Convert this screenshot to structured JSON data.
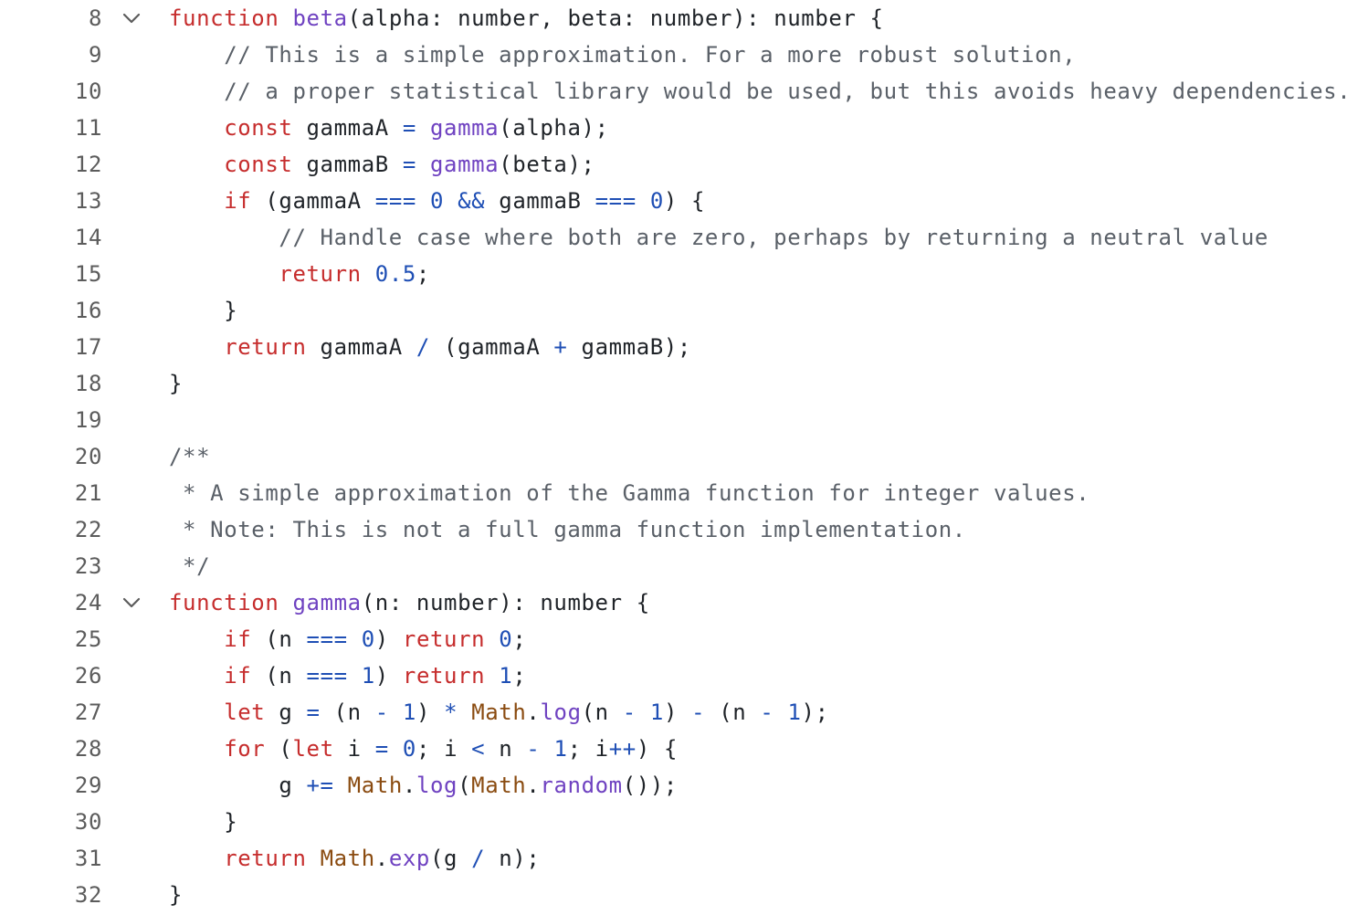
{
  "editor": {
    "language": "typescript",
    "colors": {
      "keyword": "#c62d2d",
      "function": "#6f42c1",
      "operator": "#1f4fb5",
      "number": "#1f4fb5",
      "comment": "#5a6068",
      "class": "#8a4b10",
      "text": "#1f2328",
      "line_number": "#5c5c5c"
    },
    "fold_icon": "chevron-down-icon",
    "lines": [
      {
        "num": "8",
        "fold": true,
        "tokens": [
          {
            "t": "kw",
            "v": "function"
          },
          {
            "t": "pl",
            "v": " "
          },
          {
            "t": "fn",
            "v": "beta"
          },
          {
            "t": "pl",
            "v": "(alpha: number, beta: number): number {"
          }
        ]
      },
      {
        "num": "9",
        "tokens": [
          {
            "t": "pl",
            "v": "    "
          },
          {
            "t": "cm",
            "v": "// This is a simple approximation. For a more robust solution,"
          }
        ]
      },
      {
        "num": "10",
        "tokens": [
          {
            "t": "pl",
            "v": "    "
          },
          {
            "t": "cm",
            "v": "// a proper statistical library would be used, but this avoids heavy dependencies."
          }
        ]
      },
      {
        "num": "11",
        "tokens": [
          {
            "t": "pl",
            "v": "    "
          },
          {
            "t": "kw",
            "v": "const"
          },
          {
            "t": "pl",
            "v": " gammaA "
          },
          {
            "t": "op",
            "v": "="
          },
          {
            "t": "pl",
            "v": " "
          },
          {
            "t": "fn",
            "v": "gamma"
          },
          {
            "t": "pl",
            "v": "(alpha);"
          }
        ]
      },
      {
        "num": "12",
        "tokens": [
          {
            "t": "pl",
            "v": "    "
          },
          {
            "t": "kw",
            "v": "const"
          },
          {
            "t": "pl",
            "v": " gammaB "
          },
          {
            "t": "op",
            "v": "="
          },
          {
            "t": "pl",
            "v": " "
          },
          {
            "t": "fn",
            "v": "gamma"
          },
          {
            "t": "pl",
            "v": "(beta);"
          }
        ]
      },
      {
        "num": "13",
        "tokens": [
          {
            "t": "pl",
            "v": "    "
          },
          {
            "t": "kw",
            "v": "if"
          },
          {
            "t": "pl",
            "v": " (gammaA "
          },
          {
            "t": "op",
            "v": "==="
          },
          {
            "t": "pl",
            "v": " "
          },
          {
            "t": "num",
            "v": "0"
          },
          {
            "t": "pl",
            "v": " "
          },
          {
            "t": "op",
            "v": "&&"
          },
          {
            "t": "pl",
            "v": " gammaB "
          },
          {
            "t": "op",
            "v": "==="
          },
          {
            "t": "pl",
            "v": " "
          },
          {
            "t": "num",
            "v": "0"
          },
          {
            "t": "pl",
            "v": ") {"
          }
        ]
      },
      {
        "num": "14",
        "tokens": [
          {
            "t": "pl",
            "v": "        "
          },
          {
            "t": "cm",
            "v": "// Handle case where both are zero, perhaps by returning a neutral value"
          }
        ]
      },
      {
        "num": "15",
        "tokens": [
          {
            "t": "pl",
            "v": "        "
          },
          {
            "t": "kw",
            "v": "return"
          },
          {
            "t": "pl",
            "v": " "
          },
          {
            "t": "num",
            "v": "0.5"
          },
          {
            "t": "pl",
            "v": ";"
          }
        ]
      },
      {
        "num": "16",
        "tokens": [
          {
            "t": "pl",
            "v": "    }"
          }
        ]
      },
      {
        "num": "17",
        "tokens": [
          {
            "t": "pl",
            "v": "    "
          },
          {
            "t": "kw",
            "v": "return"
          },
          {
            "t": "pl",
            "v": " gammaA "
          },
          {
            "t": "op",
            "v": "/"
          },
          {
            "t": "pl",
            "v": " (gammaA "
          },
          {
            "t": "op",
            "v": "+"
          },
          {
            "t": "pl",
            "v": " gammaB);"
          }
        ]
      },
      {
        "num": "18",
        "tokens": [
          {
            "t": "pl",
            "v": "}"
          }
        ]
      },
      {
        "num": "19",
        "tokens": []
      },
      {
        "num": "20",
        "tokens": [
          {
            "t": "cm",
            "v": "/**"
          }
        ]
      },
      {
        "num": "21",
        "tokens": [
          {
            "t": "cm",
            "v": " * A simple approximation of the Gamma function for integer values."
          }
        ]
      },
      {
        "num": "22",
        "tokens": [
          {
            "t": "cm",
            "v": " * Note: This is not a full gamma function implementation."
          }
        ]
      },
      {
        "num": "23",
        "tokens": [
          {
            "t": "cm",
            "v": " */"
          }
        ]
      },
      {
        "num": "24",
        "fold": true,
        "tokens": [
          {
            "t": "kw",
            "v": "function"
          },
          {
            "t": "pl",
            "v": " "
          },
          {
            "t": "fn",
            "v": "gamma"
          },
          {
            "t": "pl",
            "v": "(n: number): number {"
          }
        ]
      },
      {
        "num": "25",
        "tokens": [
          {
            "t": "pl",
            "v": "    "
          },
          {
            "t": "kw",
            "v": "if"
          },
          {
            "t": "pl",
            "v": " (n "
          },
          {
            "t": "op",
            "v": "==="
          },
          {
            "t": "pl",
            "v": " "
          },
          {
            "t": "num",
            "v": "0"
          },
          {
            "t": "pl",
            "v": ") "
          },
          {
            "t": "kw",
            "v": "return"
          },
          {
            "t": "pl",
            "v": " "
          },
          {
            "t": "num",
            "v": "0"
          },
          {
            "t": "pl",
            "v": ";"
          }
        ]
      },
      {
        "num": "26",
        "tokens": [
          {
            "t": "pl",
            "v": "    "
          },
          {
            "t": "kw",
            "v": "if"
          },
          {
            "t": "pl",
            "v": " (n "
          },
          {
            "t": "op",
            "v": "==="
          },
          {
            "t": "pl",
            "v": " "
          },
          {
            "t": "num",
            "v": "1"
          },
          {
            "t": "pl",
            "v": ") "
          },
          {
            "t": "kw",
            "v": "return"
          },
          {
            "t": "pl",
            "v": " "
          },
          {
            "t": "num",
            "v": "1"
          },
          {
            "t": "pl",
            "v": ";"
          }
        ]
      },
      {
        "num": "27",
        "tokens": [
          {
            "t": "pl",
            "v": "    "
          },
          {
            "t": "kw",
            "v": "let"
          },
          {
            "t": "pl",
            "v": " g "
          },
          {
            "t": "op",
            "v": "="
          },
          {
            "t": "pl",
            "v": " (n "
          },
          {
            "t": "op",
            "v": "-"
          },
          {
            "t": "pl",
            "v": " "
          },
          {
            "t": "num",
            "v": "1"
          },
          {
            "t": "pl",
            "v": ") "
          },
          {
            "t": "op",
            "v": "*"
          },
          {
            "t": "pl",
            "v": " "
          },
          {
            "t": "cls",
            "v": "Math"
          },
          {
            "t": "pl",
            "v": "."
          },
          {
            "t": "fn",
            "v": "log"
          },
          {
            "t": "pl",
            "v": "(n "
          },
          {
            "t": "op",
            "v": "-"
          },
          {
            "t": "pl",
            "v": " "
          },
          {
            "t": "num",
            "v": "1"
          },
          {
            "t": "pl",
            "v": ") "
          },
          {
            "t": "op",
            "v": "-"
          },
          {
            "t": "pl",
            "v": " (n "
          },
          {
            "t": "op",
            "v": "-"
          },
          {
            "t": "pl",
            "v": " "
          },
          {
            "t": "num",
            "v": "1"
          },
          {
            "t": "pl",
            "v": ");"
          }
        ]
      },
      {
        "num": "28",
        "tokens": [
          {
            "t": "pl",
            "v": "    "
          },
          {
            "t": "kw",
            "v": "for"
          },
          {
            "t": "pl",
            "v": " ("
          },
          {
            "t": "kw",
            "v": "let"
          },
          {
            "t": "pl",
            "v": " i "
          },
          {
            "t": "op",
            "v": "="
          },
          {
            "t": "pl",
            "v": " "
          },
          {
            "t": "num",
            "v": "0"
          },
          {
            "t": "pl",
            "v": "; i "
          },
          {
            "t": "op",
            "v": "<"
          },
          {
            "t": "pl",
            "v": " n "
          },
          {
            "t": "op",
            "v": "-"
          },
          {
            "t": "pl",
            "v": " "
          },
          {
            "t": "num",
            "v": "1"
          },
          {
            "t": "pl",
            "v": "; i"
          },
          {
            "t": "op",
            "v": "++"
          },
          {
            "t": "pl",
            "v": ") {"
          }
        ]
      },
      {
        "num": "29",
        "tokens": [
          {
            "t": "pl",
            "v": "        g "
          },
          {
            "t": "op",
            "v": "+="
          },
          {
            "t": "pl",
            "v": " "
          },
          {
            "t": "cls",
            "v": "Math"
          },
          {
            "t": "pl",
            "v": "."
          },
          {
            "t": "fn",
            "v": "log"
          },
          {
            "t": "pl",
            "v": "("
          },
          {
            "t": "cls",
            "v": "Math"
          },
          {
            "t": "pl",
            "v": "."
          },
          {
            "t": "fn",
            "v": "random"
          },
          {
            "t": "pl",
            "v": "());"
          }
        ]
      },
      {
        "num": "30",
        "tokens": [
          {
            "t": "pl",
            "v": "    }"
          }
        ]
      },
      {
        "num": "31",
        "tokens": [
          {
            "t": "pl",
            "v": "    "
          },
          {
            "t": "kw",
            "v": "return"
          },
          {
            "t": "pl",
            "v": " "
          },
          {
            "t": "cls",
            "v": "Math"
          },
          {
            "t": "pl",
            "v": "."
          },
          {
            "t": "fn",
            "v": "exp"
          },
          {
            "t": "pl",
            "v": "(g "
          },
          {
            "t": "op",
            "v": "/"
          },
          {
            "t": "pl",
            "v": " n);"
          }
        ]
      },
      {
        "num": "32",
        "tokens": [
          {
            "t": "pl",
            "v": "}"
          }
        ]
      }
    ]
  }
}
